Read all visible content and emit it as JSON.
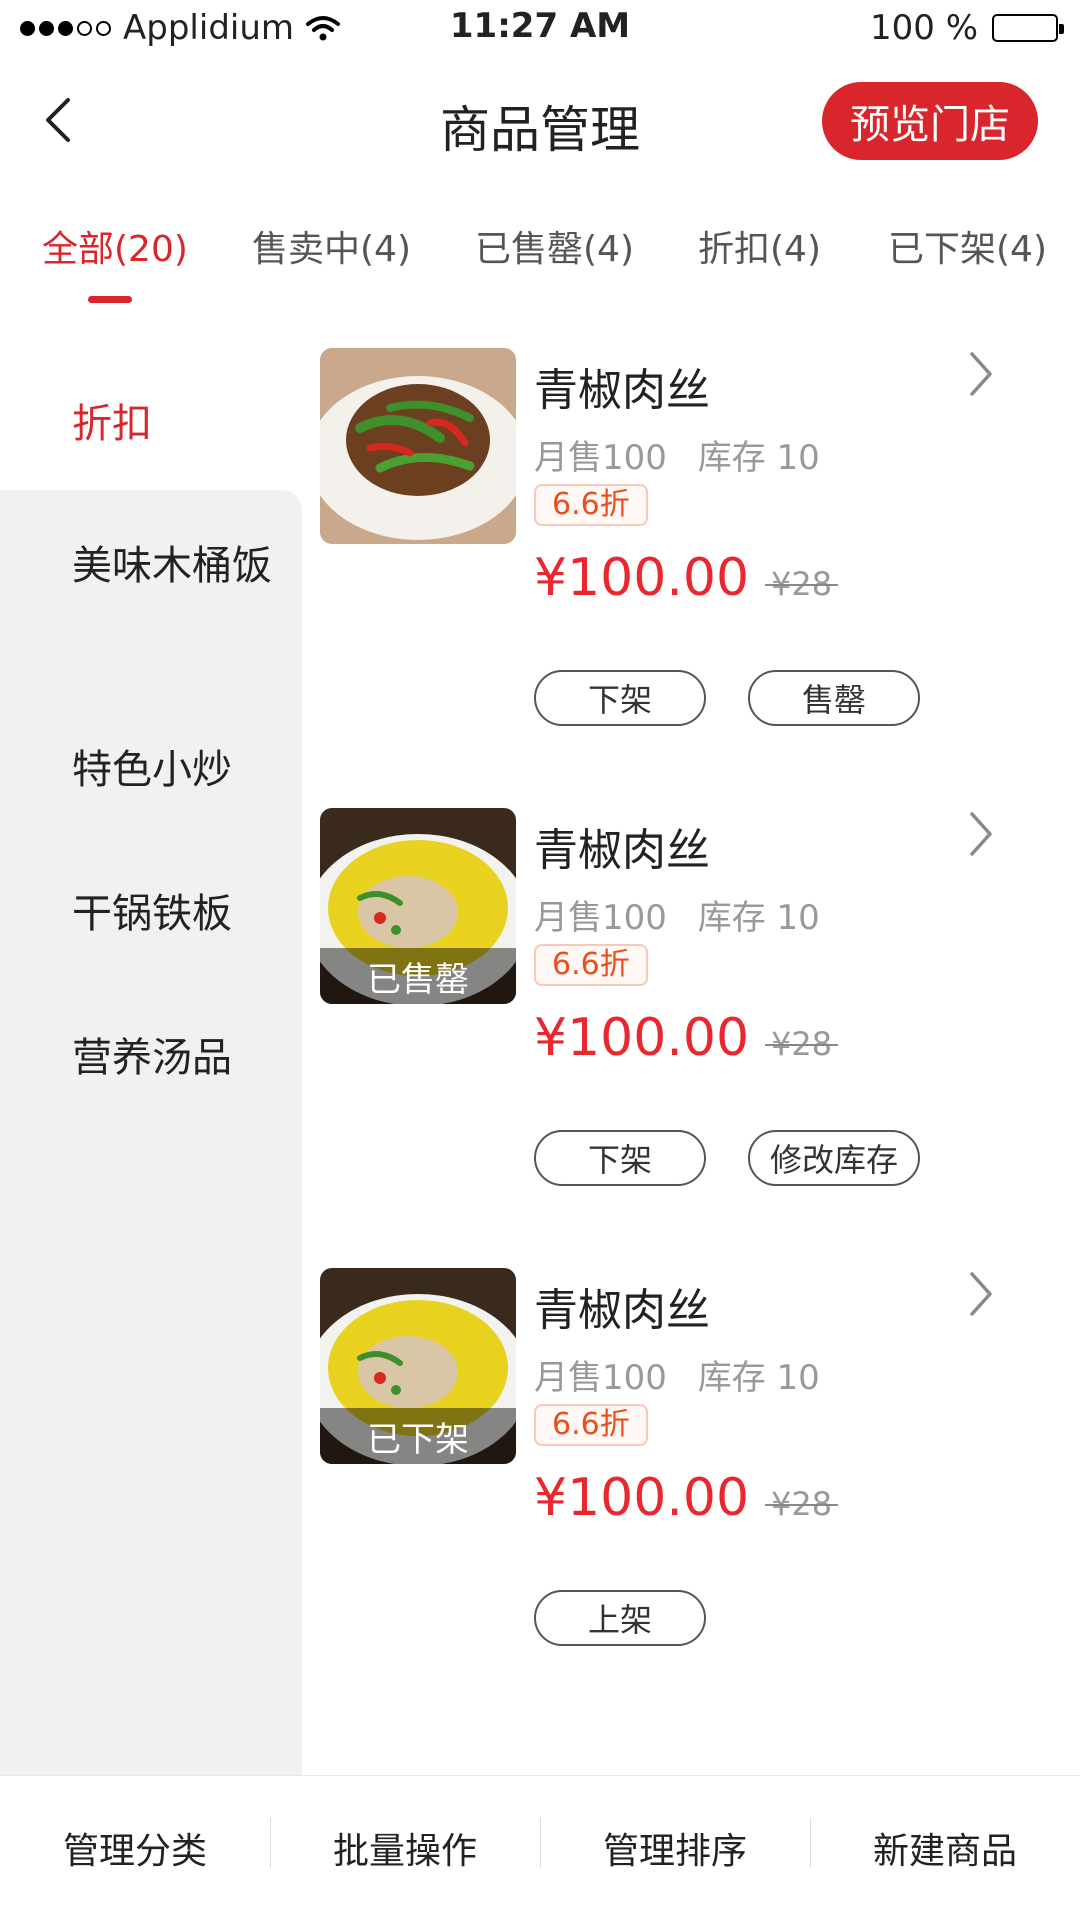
{
  "status_bar": {
    "carrier": "Applidium",
    "time": "11:27 AM",
    "battery": "100 %"
  },
  "header": {
    "title": "商品管理",
    "preview_button": "预览门店",
    "back_icon": "chevron-left-icon",
    "accent_color": "#d9262c"
  },
  "tabs": [
    {
      "label": "全部(20)",
      "active": true
    },
    {
      "label": "售卖中(4)",
      "active": false
    },
    {
      "label": "已售罄(4)",
      "active": false
    },
    {
      "label": "折扣(4)",
      "active": false
    },
    {
      "label": "已下架(4)",
      "active": false
    }
  ],
  "sidebar": {
    "categories": [
      {
        "label": "折扣",
        "active": true
      },
      {
        "label": "美味木桶饭",
        "active": false
      },
      {
        "label": "特色小炒",
        "active": false
      },
      {
        "label": "干锅铁板",
        "active": false
      },
      {
        "label": "营养汤品",
        "active": false
      }
    ]
  },
  "products": [
    {
      "name": "青椒肉丝",
      "monthly_sales": "月售100",
      "stock": "库存 10",
      "discount": "6.6折",
      "price": "¥100.00",
      "original_price": "¥28",
      "status_overlay": "",
      "actions": [
        "下架",
        "售罄"
      ]
    },
    {
      "name": "青椒肉丝",
      "monthly_sales": "月售100",
      "stock": "库存 10",
      "discount": "6.6折",
      "price": "¥100.00",
      "original_price": "¥28",
      "status_overlay": "已售罄",
      "actions": [
        "下架",
        "修改库存"
      ]
    },
    {
      "name": "青椒肉丝",
      "monthly_sales": "月售100",
      "stock": "库存 10",
      "discount": "6.6折",
      "price": "¥100.00",
      "original_price": "¥28",
      "status_overlay": "已下架",
      "actions": [
        "上架"
      ]
    }
  ],
  "bottom_bar": {
    "items": [
      "管理分类",
      "批量操作",
      "管理排序",
      "新建商品"
    ]
  }
}
